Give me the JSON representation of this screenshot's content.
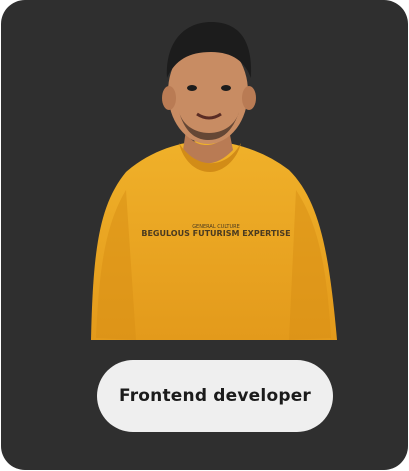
{
  "card": {
    "role_label": "Frontend developer",
    "shirt_print": "BEGULOUS FUTURISM EXPERTISE",
    "shirt_small_print": "GENERAL CULTURE",
    "colors": {
      "card_bg": "#2f2f2f",
      "pill_bg": "#efefef",
      "sweater": "#e9a623",
      "text": "#1b1b1b"
    }
  }
}
